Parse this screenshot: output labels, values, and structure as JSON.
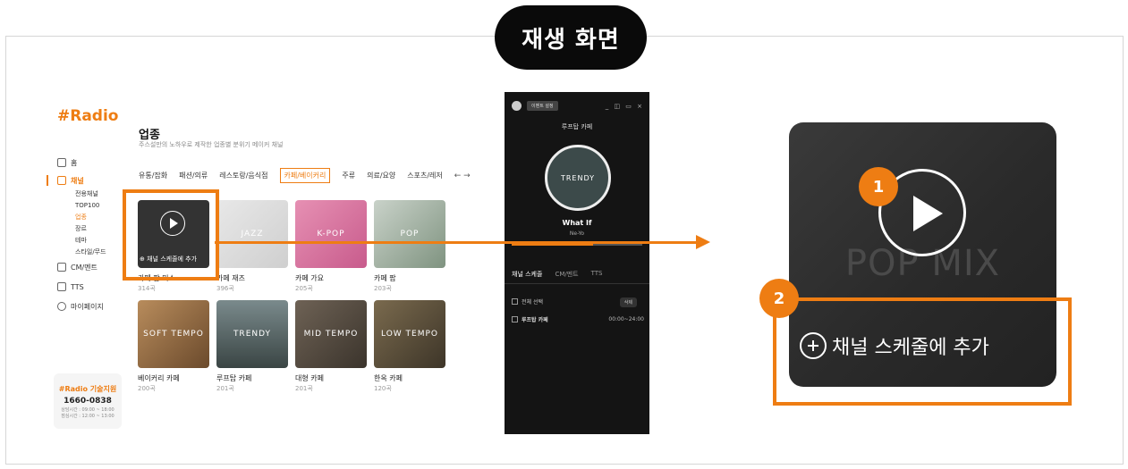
{
  "title_pill": "재생 화면",
  "app": {
    "logo": "#Radio",
    "nav": {
      "home": "홈",
      "channel": "채널",
      "sub": [
        "전용채널",
        "TOP100",
        "업종",
        "장르",
        "테마",
        "스타일/무드"
      ],
      "cm": "CM/멘트",
      "tts": "TTS",
      "mypage": "마이페이지"
    },
    "support": {
      "title": "#Radio 기술지원",
      "phone": "1660-0838",
      "hours1": "상담시간 : 09:00 ~ 18:00",
      "hours2": "점심시간 : 12:00 ~ 13:00"
    },
    "page_title": "업종",
    "page_desc": "주스설만의 노하우로 제작한 업종별 분위기 메이커 채널",
    "tabs": [
      "유통/잡화",
      "패션/의류",
      "레스토랑/음식점",
      "카페/베이커리",
      "주류",
      "의료/요양",
      "스포츠/레저"
    ],
    "tabs_arrows": "← →",
    "cards": [
      {
        "name": "카페 팝 믹스",
        "count": "314곡",
        "label": ""
      },
      {
        "name": "카페 재즈",
        "count": "396곡",
        "label": "JAZZ"
      },
      {
        "name": "카페 가요",
        "count": "205곡",
        "label": "K-POP"
      },
      {
        "name": "카페 팝",
        "count": "203곡",
        "label": "POP"
      },
      {
        "name": "베이커리 카페",
        "count": "200곡",
        "label": "SOFT TEMPO"
      },
      {
        "name": "루프탑 카페",
        "count": "201곡",
        "label": "TRENDY"
      },
      {
        "name": "대형 카페",
        "count": "201곡",
        "label": "MID TEMPO"
      },
      {
        "name": "한옥 카페",
        "count": "120곡",
        "label": "LOW TEMPO"
      }
    ],
    "add_schedule_small": "채널 스케줄에 추가"
  },
  "player": {
    "event_btn": "이벤트 설정",
    "window_icons": "_ ◫ ▭ ×",
    "channel_name": "루프탑 카페",
    "disc_label": "TRENDY",
    "song_title": "What If",
    "artist": "Ne-Yo",
    "progress": 0.62,
    "tabs": [
      "채널 스케줄",
      "CM/멘트",
      "TTS"
    ],
    "select_all": "전체 선택",
    "delete_btn": "삭제",
    "schedule_row": {
      "name": "루프탑 카페",
      "time": "00:00~24:00"
    }
  },
  "zoom": {
    "watermark": "POP MIX",
    "add_schedule": "채널 스케줄에 추가",
    "badge1": "1",
    "badge2": "2"
  },
  "colors": {
    "accent": "#ee7d13",
    "dark": "#141414"
  }
}
